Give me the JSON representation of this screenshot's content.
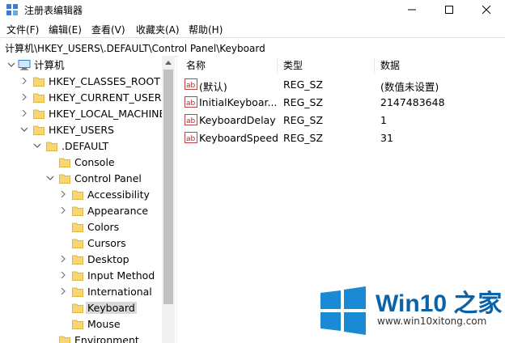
{
  "window": {
    "title": "注册表编辑器",
    "controls": {
      "minimize": "minimize-icon",
      "maximize": "maximize-icon",
      "close": "close-icon"
    }
  },
  "menu": [
    "文件(F)",
    "编辑(E)",
    "查看(V)",
    "收藏夹(A)",
    "帮助(H)"
  ],
  "address": "计算机\\HKEY_USERS\\.DEFAULT\\Control Panel\\Keyboard",
  "tree": {
    "root": "计算机",
    "items": [
      {
        "label": "HKEY_CLASSES_ROOT"
      },
      {
        "label": "HKEY_CURRENT_USER"
      },
      {
        "label": "HKEY_LOCAL_MACHINE"
      },
      {
        "label": "HKEY_USERS"
      },
      {
        "label": ".DEFAULT"
      },
      {
        "label": "Console"
      },
      {
        "label": "Control Panel"
      },
      {
        "label": "Accessibility"
      },
      {
        "label": "Appearance"
      },
      {
        "label": "Colors"
      },
      {
        "label": "Cursors"
      },
      {
        "label": "Desktop"
      },
      {
        "label": "Input Method"
      },
      {
        "label": "International"
      },
      {
        "label": "Keyboard"
      },
      {
        "label": "Mouse"
      },
      {
        "label": "Environment"
      }
    ]
  },
  "values": {
    "headers": {
      "name": "名称",
      "type": "类型",
      "data": "数据"
    },
    "rows": [
      {
        "name": "(默认)",
        "type": "REG_SZ",
        "data": "(数值未设置)"
      },
      {
        "name": "InitialKeyboar...",
        "type": "REG_SZ",
        "data": "2147483648"
      },
      {
        "name": "KeyboardDelay",
        "type": "REG_SZ",
        "data": "1"
      },
      {
        "name": "KeyboardSpeed",
        "type": "REG_SZ",
        "data": "31"
      }
    ]
  },
  "watermark": {
    "brand": "Win10 之家",
    "url": "www.win10xitong.com"
  },
  "colors": {
    "folder": "#f7d774",
    "folder_edge": "#e2b743",
    "accent_blue": "#0a62a8",
    "windows_logo": "#1a8ad4",
    "selection": "#d9d9d9"
  }
}
